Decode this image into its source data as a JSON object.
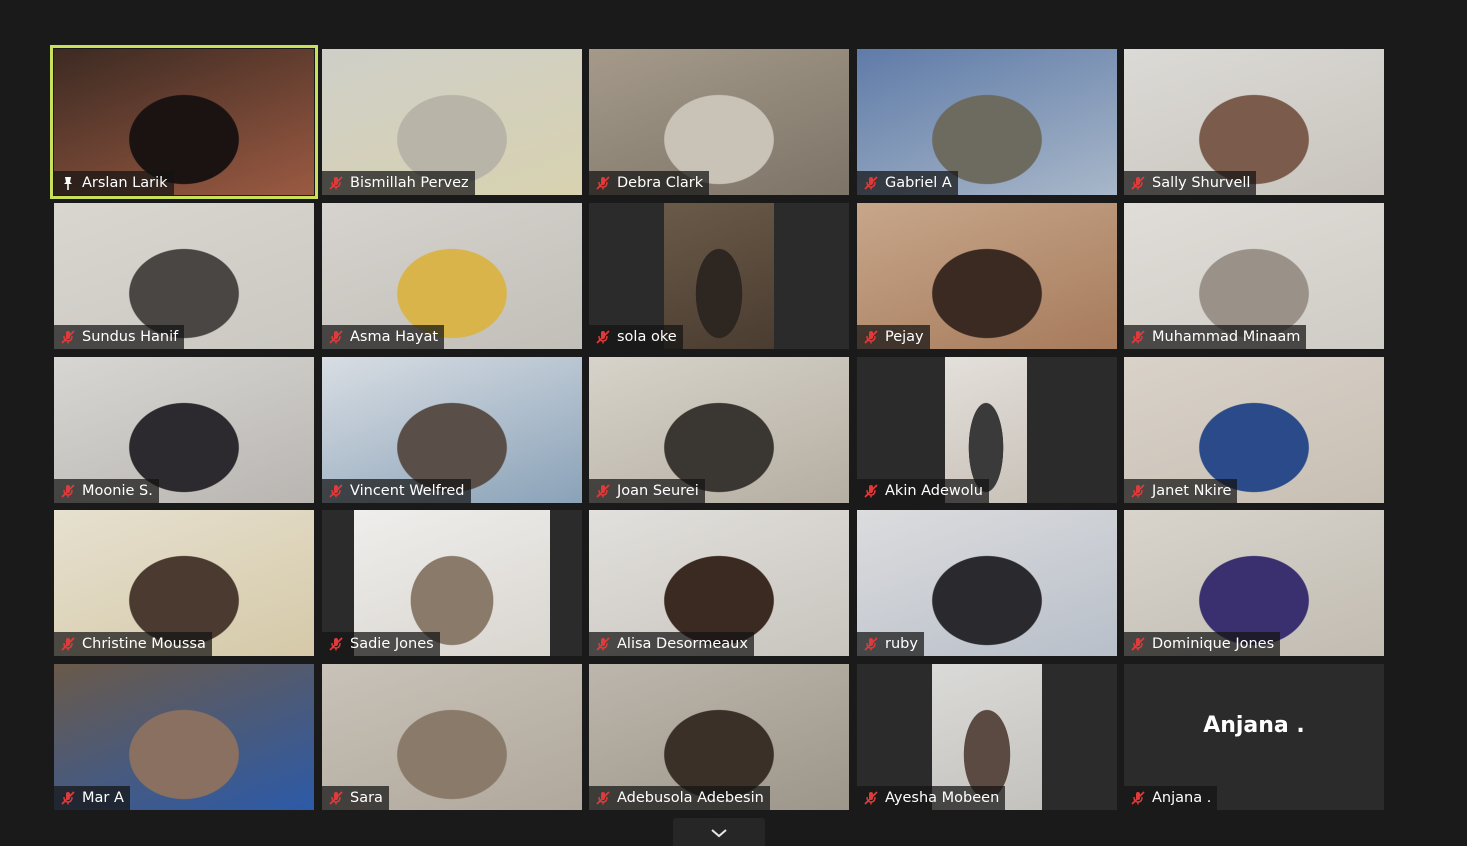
{
  "participants": [
    {
      "name": "Arslan Larik",
      "icon": "pin-icon",
      "active": true,
      "bg": [
        "#3c2a22",
        "#9b5a42",
        "#1b1311"
      ]
    },
    {
      "name": "Bismillah Pervez",
      "icon": "mic-muted-icon",
      "bg": [
        "#cfcfc8",
        "#d8d2b0",
        "#b8b4a8"
      ]
    },
    {
      "name": "Debra Clark",
      "icon": "mic-muted-icon",
      "bg": [
        "#a59a8a",
        "#7d7468",
        "#c9c2b6"
      ]
    },
    {
      "name": "Gabriel A",
      "icon": "mic-muted-icon",
      "bg": [
        "#5f7ba8",
        "#a8b7c9",
        "#6d6a60"
      ]
    },
    {
      "name": "Sally Shurvell",
      "icon": "mic-muted-icon",
      "bg": [
        "#dcdad6",
        "#c8c4bd",
        "#7a5b4c"
      ]
    },
    {
      "name": "Sundus Hanif",
      "icon": "mic-muted-icon",
      "bg": [
        "#d9d6d0",
        "#cbc8c2",
        "#4a4644"
      ]
    },
    {
      "name": "Asma Hayat",
      "icon": "mic-muted-icon",
      "bg": [
        "#d6d3ce",
        "#c2beb8",
        "#d8b44a"
      ]
    },
    {
      "name": "sola oke",
      "icon": "mic-muted-icon",
      "pillar": [
        75,
        110
      ],
      "bg": [
        "#6a5a48",
        "#4a3c30",
        "#2e2620"
      ]
    },
    {
      "name": "Pejay",
      "icon": "mic-muted-icon",
      "bg": [
        "#c7a68a",
        "#a77b5c",
        "#3a2a22"
      ]
    },
    {
      "name": "Muhammad Minaam",
      "icon": "mic-muted-icon",
      "bg": [
        "#e0ddd8",
        "#cfcbc5",
        "#9a9288"
      ]
    },
    {
      "name": "Moonie S.",
      "icon": "mic-muted-icon",
      "bg": [
        "#d8d6d2",
        "#b9b6b2",
        "#2c2a2e"
      ]
    },
    {
      "name": "Vincent Welfred",
      "icon": "mic-muted-icon",
      "bg": [
        "#d8dde3",
        "#8aa2b8",
        "#5a4e48"
      ]
    },
    {
      "name": "Joan Seurei",
      "icon": "mic-muted-icon",
      "bg": [
        "#d7d3ca",
        "#b5aea2",
        "#3a3632"
      ]
    },
    {
      "name": "Akin Adewolu",
      "icon": "mic-muted-icon",
      "pillar": [
        88,
        82
      ],
      "bg": [
        "#e3dfda",
        "#c9c2b9",
        "#3a3a3a"
      ]
    },
    {
      "name": "Janet Nkire",
      "icon": "mic-muted-icon",
      "bg": [
        "#d9d2c8",
        "#c8bfb4",
        "#2a4a8a"
      ]
    },
    {
      "name": "Christine Moussa",
      "icon": "mic-muted-icon",
      "bg": [
        "#e6e0cf",
        "#d5c9a8",
        "#4a3a30"
      ]
    },
    {
      "name": "Sadie Jones",
      "icon": "mic-muted-icon",
      "pillar": [
        32,
        196
      ],
      "bg": [
        "#efeeec",
        "#d9d5cf",
        "#8a7a6a"
      ]
    },
    {
      "name": "Alisa Desormeaux",
      "icon": "mic-muted-icon",
      "bg": [
        "#e2e0dc",
        "#c8c4be",
        "#3a2a22"
      ]
    },
    {
      "name": "ruby",
      "icon": "mic-muted-icon",
      "bg": [
        "#dcdcde",
        "#b8bfc9",
        "#2a2a2e"
      ]
    },
    {
      "name": "Dominique Jones",
      "icon": "mic-muted-icon",
      "bg": [
        "#d8d4cc",
        "#c2bcb2",
        "#3a3070"
      ]
    },
    {
      "name": "Mar A",
      "icon": "mic-muted-icon",
      "bg": [
        "#6a5a4a",
        "#2c5aa8",
        "#8a7060"
      ]
    },
    {
      "name": "Sara",
      "icon": "mic-muted-icon",
      "bg": [
        "#c9c2b8",
        "#b0a89c",
        "#8a7a6a"
      ]
    },
    {
      "name": "Adebusola Adebesin",
      "icon": "mic-muted-icon",
      "bg": [
        "#bcb6ac",
        "#9d968a",
        "#3a3028"
      ]
    },
    {
      "name": "Ayesha Mobeen",
      "icon": "mic-muted-icon",
      "pillar": [
        75,
        110
      ],
      "bg": [
        "#dadad8",
        "#c4c2bd",
        "#5a4a42"
      ]
    },
    {
      "name": "Anjana .",
      "icon": "mic-muted-icon",
      "no_video": true,
      "center_name": "Anjana ."
    }
  ],
  "controls": {
    "expand_icon": "chevron-down-icon"
  },
  "colors": {
    "active_border": "#c8e05a",
    "mic_muted": "#e03a3a",
    "background": "#1a1a1a"
  }
}
